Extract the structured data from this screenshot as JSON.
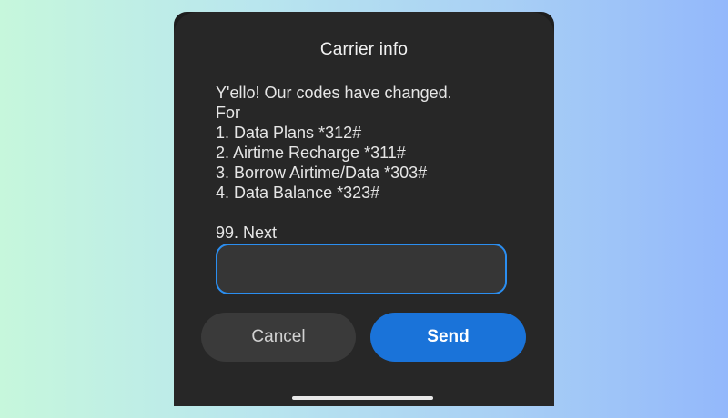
{
  "dialog": {
    "title": "Carrier info",
    "message_lines": [
      "Y'ello! Our codes have changed.",
      "For",
      "1. Data Plans *312#",
      "2. Airtime Recharge *311#",
      "3. Borrow Airtime/Data *303#",
      "4. Data Balance *323#",
      "",
      "99. Next"
    ],
    "reply": {
      "value": "",
      "placeholder": ""
    },
    "buttons": {
      "cancel_label": "Cancel",
      "send_label": "Send"
    }
  },
  "colors": {
    "dialog_background": "#272727",
    "accent": "#1a73d9",
    "input_border": "#2b8ef0",
    "cancel_background": "#3a3a3a"
  }
}
